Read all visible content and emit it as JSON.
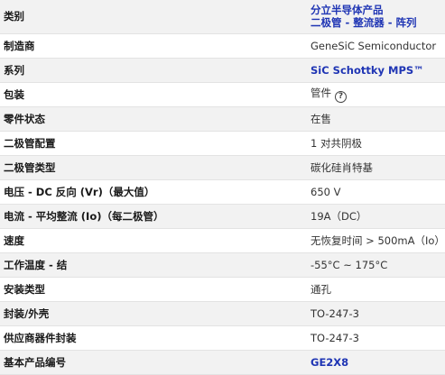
{
  "rows": [
    {
      "label": "类别",
      "value_lines": [
        "分立半导体产品",
        "二极管 - 整流器 - 阵列"
      ]
    },
    {
      "label": "制造商",
      "value": "GeneSiC Semiconductor"
    },
    {
      "label": "系列",
      "value": "SiC Schottky MPS™"
    },
    {
      "label": "包装",
      "value": "管件",
      "icon": "help-circle-icon"
    },
    {
      "label": "零件状态",
      "value": "在售"
    },
    {
      "label": "二极管配置",
      "value": "1 对共阴极"
    },
    {
      "label": "二极管类型",
      "value": "碳化硅肖特基"
    },
    {
      "label": "电压 - DC 反向 (Vr)（最大值）",
      "value": "650 V"
    },
    {
      "label": "电流 - 平均整流 (Io)（每二极管）",
      "value": "19A（DC）"
    },
    {
      "label": "速度",
      "value": "无恢复时间 > 500mA（Io）"
    },
    {
      "label": "工作温度 - 结",
      "value": "-55°C ~ 175°C"
    },
    {
      "label": "安装类型",
      "value": "通孔"
    },
    {
      "label": "封装/外壳",
      "value": "TO-247-3"
    },
    {
      "label": "供应商器件封装",
      "value": "TO-247-3"
    },
    {
      "label": "基本产品编号",
      "value": "GE2X8"
    }
  ]
}
